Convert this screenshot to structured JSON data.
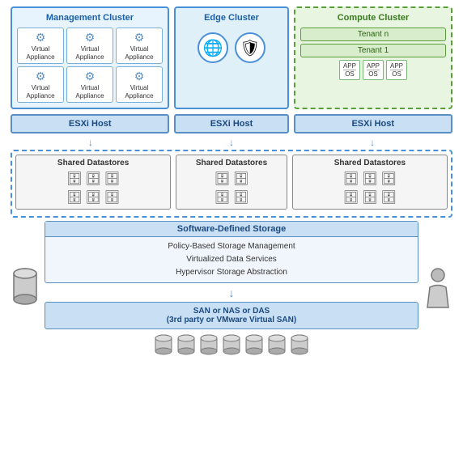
{
  "clusters": {
    "management": {
      "title": "Management Cluster",
      "appliances": [
        {
          "label": "Virtual\nAppliance"
        },
        {
          "label": "Virtual\nAppliance"
        },
        {
          "label": "Virtual\nAppliance"
        },
        {
          "label": "Virtual\nAppliance"
        },
        {
          "label": "Virtual\nAppliance"
        },
        {
          "label": "Virtual\nAppliance"
        }
      ]
    },
    "edge": {
      "title": "Edge Cluster"
    },
    "compute": {
      "title": "Compute Cluster",
      "tenants": [
        "Tenant n",
        "Tenant 1"
      ],
      "apps": [
        {
          "app": "APP",
          "os": "OS"
        },
        {
          "app": "APP",
          "os": "OS"
        },
        {
          "app": "APP",
          "os": "OS"
        }
      ]
    }
  },
  "esxi": {
    "label": "ESXi Host"
  },
  "datastores": {
    "title": "Shared Datastores"
  },
  "sds": {
    "title": "Software-Defined Storage",
    "line1": "Policy-Based Storage Management",
    "line2": "Virtualized Data Services",
    "line3": "Hypervisor Storage Abstraction"
  },
  "san": {
    "line1": "SAN or NAS or DAS",
    "line2": "(3rd party or VMware Virtual SAN)"
  },
  "icons": {
    "globe": "🌐",
    "shield": "🛡",
    "gear": "⚙"
  }
}
